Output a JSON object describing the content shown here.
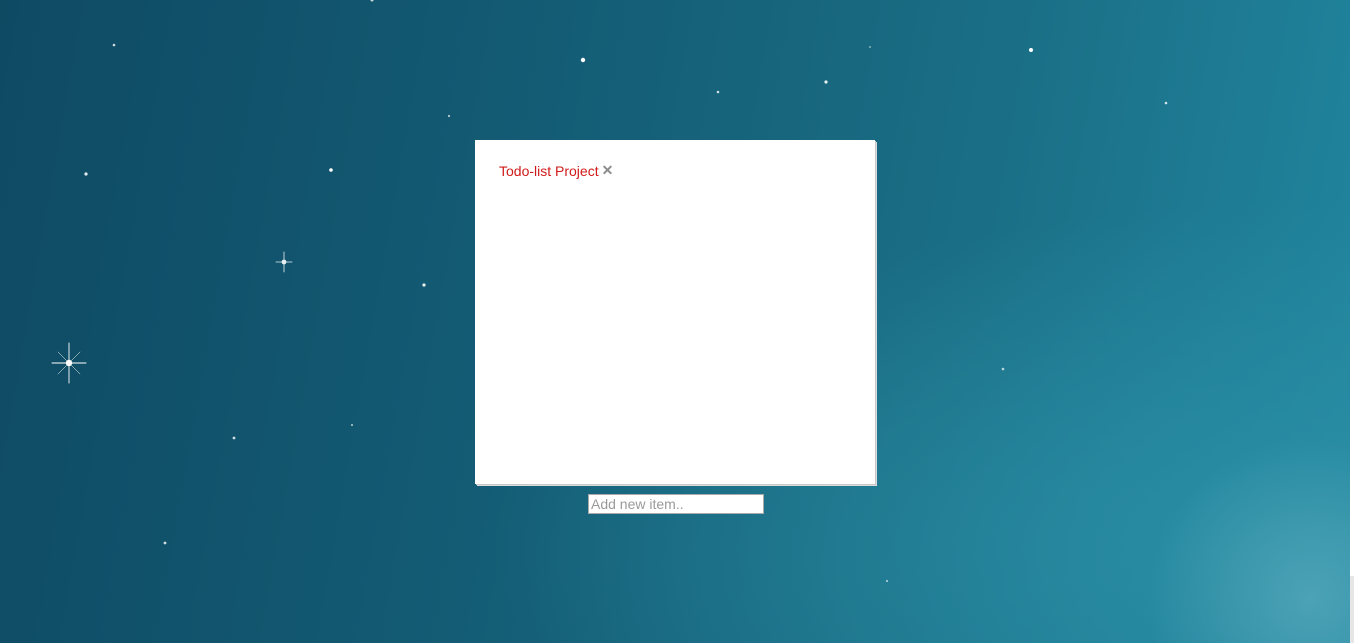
{
  "todo_list": {
    "items": [
      {
        "label": "Todo-list Project",
        "delete_icon": "✕"
      }
    ]
  },
  "new_item": {
    "value": "",
    "placeholder": "Add new item.."
  },
  "icons": {
    "delete": "close-icon"
  },
  "colors": {
    "item_text": "#d11a1a",
    "delete_icon": "#8c8c8c",
    "panel": "#ffffff"
  }
}
